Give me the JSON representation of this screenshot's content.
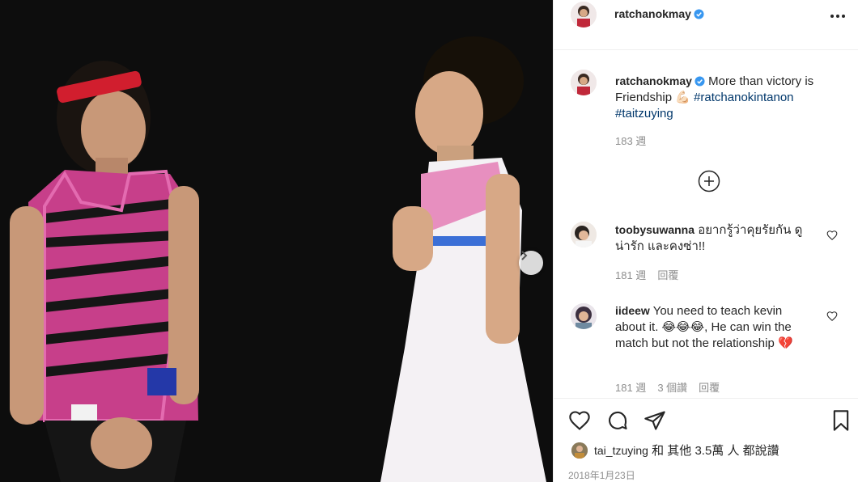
{
  "post": {
    "author": "ratchanokmay",
    "more_icon": "more-horizontal-icon"
  },
  "caption": {
    "author": "ratchanokmay",
    "text": "More than victory is Friendship",
    "emoji": "💪🏻",
    "hashtag1": "#ratchanokintanon",
    "hashtag2": "#taitzuying",
    "time": "183 週"
  },
  "comments": [
    {
      "username": "toobysuwanna",
      "text": "อยากรู้ว่าคุยรัยกัน ดูน่ารัก และคงซ่า!!",
      "time": "181 週",
      "reply": "回覆"
    },
    {
      "username": "iideew",
      "text": "You need to teach kevin about it. 😂😂😂, He can win the match but not the relationship 💔",
      "time": "181 週",
      "likes": "3 個讚",
      "reply": "回覆"
    }
  ],
  "likes": {
    "user": "tai_tzuying",
    "rest": "和 其他 3.5萬 人 都說讚"
  },
  "date": "2018年1月23日",
  "colors": {
    "link": "#00376b",
    "muted": "#8e8e8e",
    "verified": "#3897f0"
  }
}
